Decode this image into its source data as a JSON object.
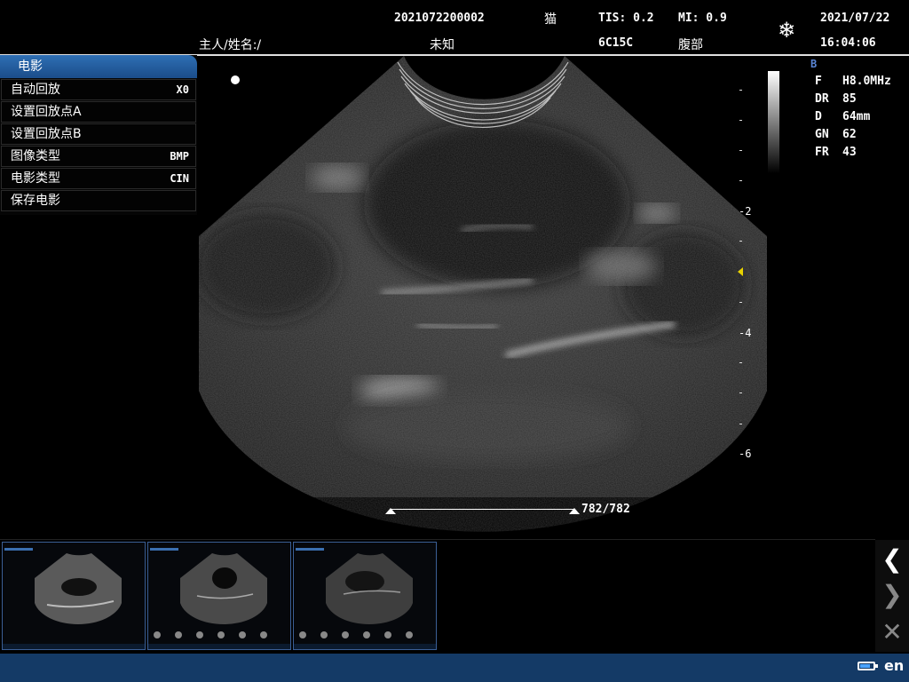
{
  "header": {
    "patient_id": "2021072200002",
    "species": "猫",
    "tis": "TIS: 0.2",
    "mi": "MI: 0.9",
    "date": "2021/07/22",
    "owner_label": "主人/姓名:/",
    "name_value": "未知",
    "probe": "6C15C",
    "exam": "腹部",
    "time": "16:04:06",
    "freeze_icon": "snowflake-icon"
  },
  "cine_menu": {
    "title": "电影",
    "items": [
      {
        "label": "自动回放",
        "value": "X0"
      },
      {
        "label": "设置回放点A",
        "value": ""
      },
      {
        "label": "设置回放点B",
        "value": ""
      },
      {
        "label": "图像类型",
        "value": "BMP"
      },
      {
        "label": "电影类型",
        "value": "CIN"
      },
      {
        "label": "保存电影",
        "value": ""
      }
    ]
  },
  "scale": {
    "labels": [
      "-2",
      "-4",
      "-6"
    ]
  },
  "params": {
    "mode": "B",
    "rows": [
      {
        "label": "F",
        "value": "H8.0MHz"
      },
      {
        "label": "DR",
        "value": "85"
      },
      {
        "label": "D",
        "value": "64mm"
      },
      {
        "label": "GN",
        "value": "62"
      },
      {
        "label": "FR",
        "value": "43"
      }
    ]
  },
  "cine": {
    "counter": "782/782"
  },
  "thumbnails": [
    {
      "name": "thumbnail-1"
    },
    {
      "name": "thumbnail-2"
    },
    {
      "name": "thumbnail-3"
    }
  ],
  "nav": {
    "prev_icon": "chevron-left-icon",
    "next_icon": "chevron-right-icon",
    "delete_icon": "close-icon"
  },
  "status": {
    "language": "en",
    "battery_icon": "battery-icon",
    "battery_level": 0.8
  },
  "colors": {
    "menu_title": "#2e6fb4",
    "bottom_bar": "#143a66",
    "thumb_border": "#3b5f96",
    "mode_label": "#5a86d6",
    "focus_marker": "#e8d200"
  }
}
